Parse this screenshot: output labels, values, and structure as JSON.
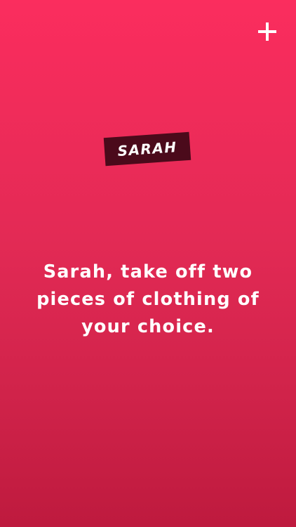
{
  "player": {
    "name": "SARAH"
  },
  "dare": {
    "text": "Sarah, take off two pieces of clothing of your choice."
  },
  "actions": {
    "add_icon": "plus-icon"
  },
  "colors": {
    "background_top": "#fb2d5e",
    "background_bottom": "#be1a3e",
    "tag_background": "#4b0a1b",
    "text": "#ffffff"
  }
}
